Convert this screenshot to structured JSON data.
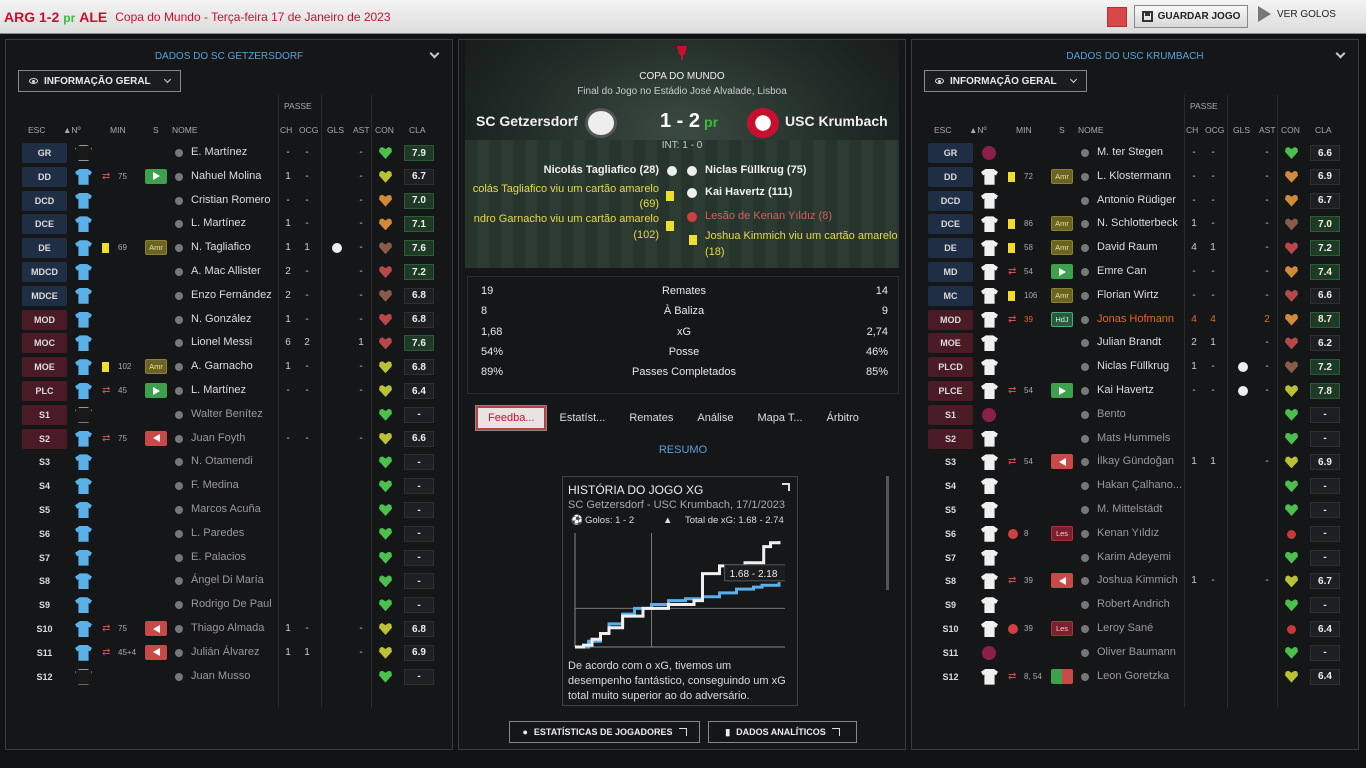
{
  "topbar": {
    "score_text": "ARG 1-2",
    "pr": "pr",
    "score_ale": "ALE",
    "competition": "Copa do Mundo - Terça-feira 17 de Janeiro de 2023",
    "save": "GUARDAR JOGO",
    "goals": "VER GOLOS"
  },
  "colors": {
    "accent_red": "#c8102e",
    "link_blue": "#5aa2d8",
    "rating_green": "#3cbc3c"
  },
  "left": {
    "title": "DADOS DO SC GETZERSDORF",
    "dropdown": "INFORMAÇÃO GERAL",
    "headers": {
      "passe": "PASSE",
      "esc": "ESC",
      "num": "▲Nº",
      "min": "MIN",
      "s": "S",
      "nome": "NOME",
      "ch": "CH",
      "ocg": "OCG",
      "gls": "GLS",
      "ast": "AST",
      "con": "CON",
      "cla": "CLA"
    },
    "rows": [
      {
        "pos": "GR",
        "posc": "blue",
        "shirt": "black",
        "name": "E. Martínez",
        "ch": "-",
        "ocg": "-",
        "gls": "",
        "ast": "-",
        "heart": "g",
        "rating": "7.9",
        "rc": "gr"
      },
      {
        "pos": "DD",
        "posc": "blue",
        "shirt": "cyan",
        "ic": "sub",
        "mins": "75",
        "tag": "grn",
        "name": "Nahuel Molina",
        "ch": "1",
        "ocg": "-",
        "gls": "",
        "ast": "-",
        "heart": "y",
        "rating": "6.7"
      },
      {
        "pos": "DCD",
        "posc": "blue",
        "shirt": "cyan",
        "name": "Cristian Romero",
        "ch": "-",
        "ocg": "-",
        "gls": "",
        "ast": "-",
        "heart": "o",
        "rating": "7.0",
        "rc": "gr"
      },
      {
        "pos": "DCE",
        "posc": "blue",
        "shirt": "cyan",
        "name": "L. Martínez",
        "ch": "1",
        "ocg": "-",
        "gls": "",
        "ast": "-",
        "heart": "o",
        "rating": "7.1",
        "rc": "gr"
      },
      {
        "pos": "DE",
        "posc": "blue",
        "shirt": "cyan",
        "ic": "yc",
        "mins": "69",
        "tag": "amr",
        "tagtxt": "Amr",
        "name": "N. Tagliafico",
        "ch": "1",
        "ocg": "1",
        "gls": "",
        "ball": true,
        "ast": "-",
        "heart": "b",
        "rating": "7.6",
        "rc": "gr"
      },
      {
        "pos": "MDCD",
        "posc": "blue",
        "shirt": "cyan",
        "name": "A. Mac Allister",
        "ch": "2",
        "ocg": "-",
        "gls": "",
        "ast": "-",
        "heart": "r",
        "rating": "7.2",
        "rc": "gr"
      },
      {
        "pos": "MDCE",
        "posc": "blue",
        "shirt": "cyan",
        "name": "Enzo Fernández",
        "ch": "2",
        "ocg": "-",
        "gls": "",
        "ast": "-",
        "heart": "b",
        "rating": "6.8"
      },
      {
        "pos": "MOD",
        "posc": "red",
        "shirt": "cyan",
        "name": "N. González",
        "ch": "1",
        "ocg": "-",
        "gls": "",
        "ast": "-",
        "heart": "r",
        "rating": "6.8"
      },
      {
        "pos": "MOC",
        "posc": "red",
        "shirt": "cyan",
        "name": "Lionel Messi",
        "ch": "6",
        "ocg": "2",
        "gls": "",
        "ast": "1",
        "heart": "r",
        "rating": "7.6",
        "rc": "gr"
      },
      {
        "pos": "MOE",
        "posc": "red",
        "shirt": "cyan",
        "ic": "yc",
        "mins": "102",
        "tag": "amr",
        "tagtxt": "Amr",
        "name": "A. Garnacho",
        "ch": "1",
        "ocg": "-",
        "gls": "",
        "ast": "-",
        "heart": "y",
        "rating": "6.8"
      },
      {
        "pos": "PLC",
        "posc": "red",
        "shirt": "cyan",
        "ic": "sub",
        "mins": "45",
        "tag": "grn",
        "name": "L. Martínez",
        "ch": "-",
        "ocg": "-",
        "gls": "",
        "ast": "-",
        "heart": "y",
        "rating": "6.4"
      },
      {
        "pos": "S1",
        "posc": "red",
        "shirt": "black",
        "name": "Walter Benítez",
        "dim": true,
        "heart": "g",
        "rating": "-"
      },
      {
        "pos": "S2",
        "posc": "red",
        "shirt": "cyan",
        "ic": "sub",
        "mins": "75",
        "tag": "red",
        "name": "Juan Foyth",
        "dim": true,
        "ch": "-",
        "ocg": "-",
        "ast": "-",
        "heart": "y",
        "rating": "6.6"
      },
      {
        "pos": "S3",
        "posc": "",
        "shirt": "cyan",
        "name": "N. Otamendi",
        "dim": true,
        "heart": "g",
        "rating": "-"
      },
      {
        "pos": "S4",
        "posc": "",
        "shirt": "cyan",
        "name": "F. Medina",
        "dim": true,
        "heart": "g",
        "rating": "-"
      },
      {
        "pos": "S5",
        "posc": "",
        "shirt": "cyan",
        "name": "Marcos Acuña",
        "dim": true,
        "heart": "g",
        "rating": "-"
      },
      {
        "pos": "S6",
        "posc": "",
        "shirt": "cyan",
        "name": "L. Paredes",
        "dim": true,
        "heart": "g",
        "rating": "-"
      },
      {
        "pos": "S7",
        "posc": "",
        "shirt": "cyan",
        "name": "E. Palacios",
        "dim": true,
        "heart": "g",
        "rating": "-"
      },
      {
        "pos": "S8",
        "posc": "",
        "shirt": "cyan",
        "name": "Ángel Di María",
        "dim": true,
        "heart": "g",
        "rating": "-"
      },
      {
        "pos": "S9",
        "posc": "",
        "shirt": "cyan",
        "name": "Rodrigo De Paul",
        "dim": true,
        "heart": "g",
        "rating": "-"
      },
      {
        "pos": "S10",
        "posc": "",
        "shirt": "cyan",
        "ic": "sub",
        "mins": "75",
        "tag": "red",
        "name": "Thiago Almada",
        "dim": true,
        "ch": "1",
        "ocg": "-",
        "ast": "-",
        "heart": "y",
        "rating": "6.8"
      },
      {
        "pos": "S11",
        "posc": "",
        "shirt": "cyan",
        "ic": "sub",
        "mins": "45+4",
        "tag": "red",
        "name": "Julián Álvarez",
        "dim": true,
        "ch": "1",
        "ocg": "1",
        "ast": "-",
        "heart": "y",
        "rating": "6.9"
      },
      {
        "pos": "S12",
        "posc": "",
        "shirt": "black",
        "name": "Juan Musso",
        "dim": true,
        "heart": "g",
        "rating": "-"
      }
    ]
  },
  "right": {
    "title": "DADOS DO USC KRUMBACH",
    "dropdown": "INFORMAÇÃO GERAL",
    "headers": {
      "passe": "PASSE",
      "esc": "ESC",
      "num": "▲Nº",
      "min": "MIN",
      "s": "S",
      "nome": "NOME",
      "ch": "CH",
      "ocg": "OCG",
      "gls": "GLS",
      "ast": "AST",
      "con": "CON",
      "cla": "CLA"
    },
    "rows": [
      {
        "pos": "GR",
        "posc": "blue",
        "shirt": "maroon",
        "name": "M. ter Stegen",
        "ch": "-",
        "ocg": "-",
        "ast": "-",
        "heart": "g",
        "rating": "6.6"
      },
      {
        "pos": "DD",
        "posc": "blue",
        "shirt": "white",
        "ic": "yc",
        "mins": "72",
        "tag": "amr",
        "tagtxt": "Amr",
        "name": "L. Klostermann",
        "ch": "-",
        "ocg": "-",
        "ast": "-",
        "heart": "o",
        "rating": "6.9"
      },
      {
        "pos": "DCD",
        "posc": "blue",
        "shirt": "white",
        "name": "Antonio Rüdiger",
        "ch": "-",
        "ocg": "-",
        "ast": "-",
        "heart": "o",
        "rating": "6.7"
      },
      {
        "pos": "DCE",
        "posc": "blue",
        "shirt": "white",
        "ic": "yc",
        "mins": "86",
        "tag": "amr",
        "tagtxt": "Amr",
        "name": "N. Schlotterbeck",
        "ch": "1",
        "ocg": "-",
        "ast": "-",
        "heart": "b",
        "rating": "7.0",
        "rc": "gr"
      },
      {
        "pos": "DE",
        "posc": "blue",
        "shirt": "white",
        "ic": "yc",
        "mins": "58",
        "tag": "amr",
        "tagtxt": "Amr",
        "name": "David Raum",
        "ch": "4",
        "ocg": "1",
        "ast": "-",
        "heart": "r",
        "rating": "7.2",
        "rc": "gr"
      },
      {
        "pos": "MD",
        "posc": "blue",
        "shirt": "white",
        "ic": "sub",
        "mins": "54",
        "tag": "grn",
        "name": "Emre Can",
        "ch": "-",
        "ocg": "-",
        "ast": "-",
        "heart": "o",
        "rating": "7.4",
        "rc": "gr"
      },
      {
        "pos": "MC",
        "posc": "blue",
        "shirt": "white",
        "ic": "yc",
        "mins": "106",
        "tag": "amr",
        "tagtxt": "Amr",
        "name": "Florian Wirtz",
        "ch": "-",
        "ocg": "-",
        "ast": "-",
        "heart": "r",
        "rating": "6.6"
      },
      {
        "pos": "MOD",
        "posc": "red",
        "shirt": "white",
        "ic": "sub",
        "mins": "39",
        "minsc": "orange",
        "tag": "hdj",
        "tagtxt": "HdJ",
        "name": "Jonas Hofmann",
        "nc": "orange",
        "ch": "4",
        "ocg": "4",
        "ast": "2",
        "orangestats": true,
        "heart": "o",
        "rating": "8.7",
        "rc": "gr"
      },
      {
        "pos": "MOE",
        "posc": "red",
        "shirt": "white",
        "name": "Julian Brandt",
        "ch": "2",
        "ocg": "1",
        "ast": "-",
        "heart": "r",
        "rating": "6.2"
      },
      {
        "pos": "PLCD",
        "posc": "red",
        "shirt": "white",
        "name": "Niclas Füllkrug",
        "ch": "1",
        "ocg": "-",
        "ball": true,
        "ast": "-",
        "heart": "b",
        "rating": "7.2",
        "rc": "gr"
      },
      {
        "pos": "PLCE",
        "posc": "red",
        "shirt": "white",
        "ic": "sub",
        "mins": "54",
        "tag": "grn",
        "name": "Kai Havertz",
        "ch": "-",
        "ocg": "-",
        "ball": true,
        "ast": "-",
        "heart": "y",
        "rating": "7.8",
        "rc": "gr"
      },
      {
        "pos": "S1",
        "posc": "red",
        "shirt": "maroon",
        "name": "Bento",
        "dim": true,
        "heart": "g",
        "rating": "-"
      },
      {
        "pos": "S2",
        "posc": "red",
        "shirt": "white",
        "name": "Mats Hummels",
        "dim": true,
        "heart": "g",
        "rating": "-"
      },
      {
        "pos": "S3",
        "posc": "",
        "shirt": "white",
        "ic": "sub",
        "mins": "54",
        "tag": "red",
        "name": "İlkay Gündoğan",
        "dim": true,
        "ch": "1",
        "ocg": "1",
        "ast": "-",
        "heart": "y",
        "rating": "6.9"
      },
      {
        "pos": "S4",
        "posc": "",
        "shirt": "white",
        "name": "Hakan Çalhano...",
        "dim": true,
        "heart": "g",
        "rating": "-"
      },
      {
        "pos": "S5",
        "posc": "",
        "shirt": "white",
        "name": "M. Mittelstädt",
        "dim": true,
        "heart": "g",
        "rating": "-"
      },
      {
        "pos": "S6",
        "posc": "",
        "shirt": "white",
        "ic": "rc",
        "mins": "8",
        "tag": "les",
        "tagtxt": "Les",
        "name": "Kenan Yıldız",
        "dim": true,
        "heart": "dot",
        "rating": "-"
      },
      {
        "pos": "S7",
        "posc": "",
        "shirt": "white",
        "name": "Karim Adeyemi",
        "dim": true,
        "heart": "g",
        "rating": "-"
      },
      {
        "pos": "S8",
        "posc": "",
        "shirt": "white",
        "ic": "sub",
        "mins": "39",
        "tag": "red",
        "name": "Joshua Kimmich",
        "dim": true,
        "ch": "1",
        "ocg": "-",
        "ast": "-",
        "heart": "y",
        "rating": "6.7"
      },
      {
        "pos": "S9",
        "posc": "",
        "shirt": "white",
        "name": "Robert Andrich",
        "dim": true,
        "heart": "g",
        "rating": "-"
      },
      {
        "pos": "S10",
        "posc": "",
        "shirt": "white",
        "ic": "rc",
        "mins": "39",
        "tag": "les",
        "tagtxt": "Les",
        "name": "Leroy Sané",
        "dim": true,
        "heart": "dot",
        "rating": "6.4"
      },
      {
        "pos": "S11",
        "posc": "",
        "shirt": "maroon",
        "name": "Oliver Baumann",
        "dim": true,
        "heart": "g",
        "rating": "-"
      },
      {
        "pos": "S12",
        "posc": "",
        "shirt": "white",
        "ic": "sub",
        "mins": "8, 54",
        "tag": "grnred",
        "name": "Leon Goretzka",
        "dim": true,
        "heart": "y",
        "rating": "6.4"
      }
    ]
  },
  "match": {
    "competition": "COPA DO MUNDO",
    "venue": "Final do Jogo no Estádio José Alvalade, Lisboa",
    "home": "SC Getzersdorf",
    "away": "USC Krumbach",
    "score": "1 - 2",
    "pr": "pr",
    "ht": "INT: 1 - 0",
    "events_home": [
      "Nicolás Tagliafico (28)",
      "colás Tagliafico viu um cartão amarelo",
      "(69)",
      "ndro Garnacho viu um cartão amarelo",
      "(102)"
    ],
    "events_away": [
      "Niclas Füllkrug (75)",
      "Kai Havertz (111)",
      "Lesão de Kenan Yıldız (8)",
      "Joshua Kimmich viu um cartão amarelo",
      "(18)"
    ]
  },
  "stats": [
    {
      "l": "19",
      "m": "Remates",
      "r": "14"
    },
    {
      "l": "8",
      "m": "À Baliza",
      "r": "9"
    },
    {
      "l": "1,68",
      "m": "xG",
      "r": "2,74"
    },
    {
      "l": "54%",
      "m": "Posse",
      "r": "46%"
    },
    {
      "l": "89%",
      "m": "Passes Completados",
      "r": "85%"
    }
  ],
  "tabs": [
    "Feedba...",
    "Estatíst...",
    "Remates",
    "Análise",
    "Mapa T...",
    "Árbitro"
  ],
  "resumo": "RESUMO",
  "xg": {
    "title": "HISTÓRIA DO JOGO XG",
    "sub": "SC Getzersdorf - USC Krumbach, 17/1/2023",
    "goals": "Golos: 1 - 2",
    "total": "Total de xG: 1.68 - 2.74",
    "tooltip": "1.68 - 2.18",
    "text": "De acordo com o xG, tivemos um desempenho fantástico, conseguindo um xG total muito superior ao do adversário."
  },
  "chart_data": {
    "type": "line",
    "title": "HISTÓRIA DO JOGO XG",
    "series": [
      {
        "color": "#5ab0e8",
        "x": [
          0,
          8,
          15,
          20,
          28,
          35,
          45,
          55,
          65,
          75,
          85,
          95,
          105,
          110,
          120
        ],
        "values": [
          0,
          0.15,
          0.35,
          0.6,
          0.85,
          1.0,
          1.1,
          1.2,
          1.25,
          1.3,
          1.4,
          1.5,
          1.55,
          1.6,
          1.68
        ]
      },
      {
        "color": "#f0f0f0",
        "x": [
          0,
          5,
          10,
          15,
          20,
          28,
          40,
          55,
          70,
          75,
          85,
          100,
          111,
          115,
          120
        ],
        "values": [
          0,
          0.05,
          0.2,
          0.35,
          0.5,
          0.8,
          1.0,
          1.1,
          1.2,
          1.9,
          2.1,
          2.18,
          2.6,
          2.7,
          2.74
        ]
      }
    ]
  },
  "buttons": {
    "player_stats": "ESTATÍSTICAS DE JOGADORES",
    "analytics": "DADOS ANALÍTICOS"
  }
}
